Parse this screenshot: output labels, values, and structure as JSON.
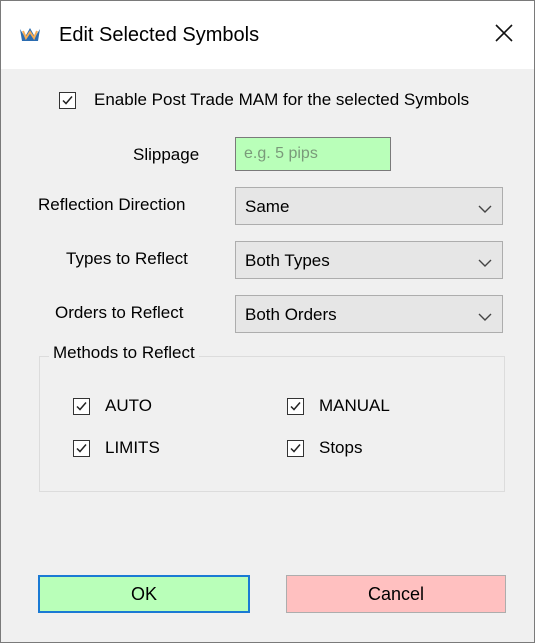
{
  "window": {
    "title": "Edit Selected Symbols",
    "close_glyph": "✕",
    "icon": "app-logo-icon"
  },
  "enable_checkbox": {
    "label": "Enable Post Trade MAM for the selected Symbols",
    "checked": true
  },
  "slippage": {
    "label": "Slippage",
    "value": "",
    "placeholder": "e.g. 5 pips"
  },
  "reflection_direction": {
    "label": "Reflection Direction",
    "value": "Same"
  },
  "types_to_reflect": {
    "label": "Types to Reflect",
    "value": "Both Types"
  },
  "orders_to_reflect": {
    "label": "Orders to Reflect",
    "value": "Both Orders"
  },
  "methods_group": {
    "legend": "Methods to Reflect",
    "items": [
      {
        "label": "AUTO",
        "checked": true
      },
      {
        "label": "MANUAL",
        "checked": true
      },
      {
        "label": "LIMITS",
        "checked": true
      },
      {
        "label": "Stops",
        "checked": true
      }
    ]
  },
  "buttons": {
    "ok": "OK",
    "cancel": "Cancel"
  },
  "colors": {
    "ok_bg": "#b9ffb9",
    "cancel_bg": "#ffc0c0",
    "slippage_bg": "#b9ffb9",
    "focus_border": "#1a7ad4"
  }
}
